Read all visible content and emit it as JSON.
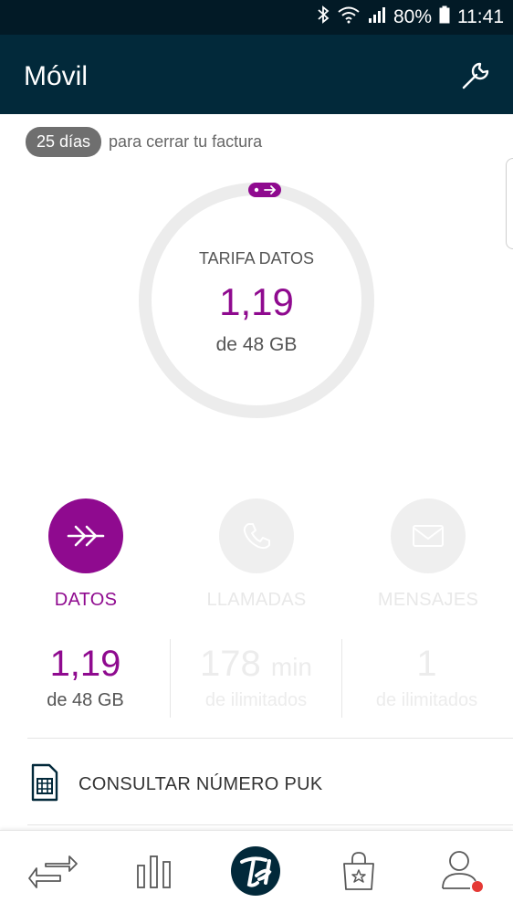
{
  "status_bar": {
    "battery": "80%",
    "time": "11:41"
  },
  "app_bar": {
    "title": "Móvil"
  },
  "billing": {
    "days": "25 días",
    "text": "para cerrar tu factura"
  },
  "ring": {
    "caption": "TARIFA DATOS",
    "value": "1,19",
    "subtitle": "de 48 GB"
  },
  "categories": [
    {
      "label": "DATOS",
      "icon": "data-arrow-icon",
      "active": true
    },
    {
      "label": "LLAMADAS",
      "icon": "phone-icon",
      "active": false
    },
    {
      "label": "MENSAJES",
      "icon": "envelope-icon",
      "active": false
    }
  ],
  "stats": [
    {
      "value": "1,19",
      "unit": "",
      "sub": "de 48 GB"
    },
    {
      "value": "178",
      "unit": "min",
      "sub": "de ilimitados"
    },
    {
      "value": "1",
      "unit": "",
      "sub": "de ilimitados"
    }
  ],
  "puk": {
    "label": "CONSULTAR NÚMERO PUK",
    "icon": "sim-card-icon"
  },
  "bottom_nav": [
    {
      "icon": "swap-arrows-icon"
    },
    {
      "icon": "bar-chart-icon"
    },
    {
      "icon": "brand-logo-icon"
    },
    {
      "icon": "shopping-bag-icon"
    },
    {
      "icon": "profile-icon",
      "badge_color": "#e53935"
    }
  ],
  "colors": {
    "accent": "#8f0a8f",
    "header": "#02293a",
    "statusbar": "#021a26"
  }
}
